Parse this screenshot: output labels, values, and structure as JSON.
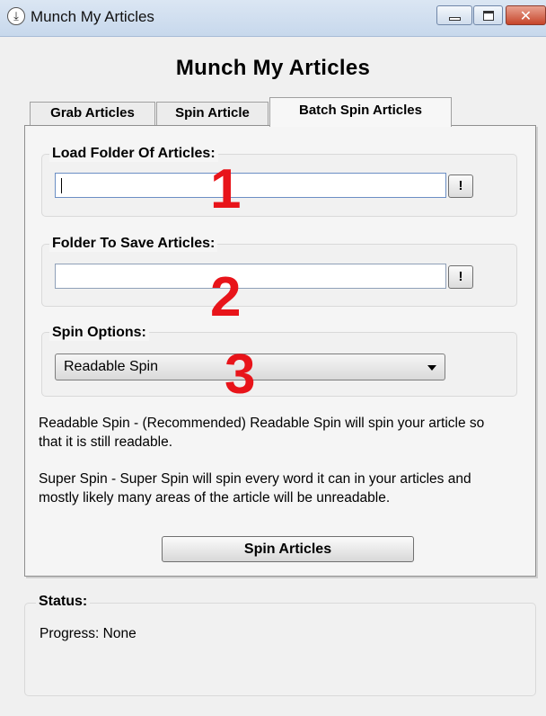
{
  "window": {
    "title": "Munch My Articles",
    "icon": "app-download-icon",
    "controls": {
      "minimize": "minimize-icon",
      "maximize": "maximize-icon",
      "close": "✕"
    }
  },
  "heading": "Munch My Articles",
  "tabs": [
    {
      "label": "Grab Articles",
      "selected": false
    },
    {
      "label": "Spin Article",
      "selected": false
    },
    {
      "label": "Batch Spin Articles",
      "selected": true
    }
  ],
  "load_folder": {
    "label": "Load Folder Of Articles:",
    "value": "",
    "browse_label": "!"
  },
  "save_folder": {
    "label": "Folder To Save Articles:",
    "value": "",
    "browse_label": "!"
  },
  "spin_options": {
    "label": "Spin Options:",
    "selected": "Readable Spin"
  },
  "annotations": [
    "1",
    "2",
    "3"
  ],
  "descriptions": {
    "readable": "Readable Spin - (Recommended) Readable Spin will spin your article so that it is still readable.",
    "super": "Super Spin - Super Spin will spin every word it can in your articles and mostly likely many areas of the article will be unreadable."
  },
  "spin_button": "Spin Articles",
  "status": {
    "label": "Status:",
    "progress": "Progress: None"
  },
  "colors": {
    "annotation": "#e8141a",
    "titlebar": "#c7d8ec",
    "close_button": "#c6452a"
  }
}
